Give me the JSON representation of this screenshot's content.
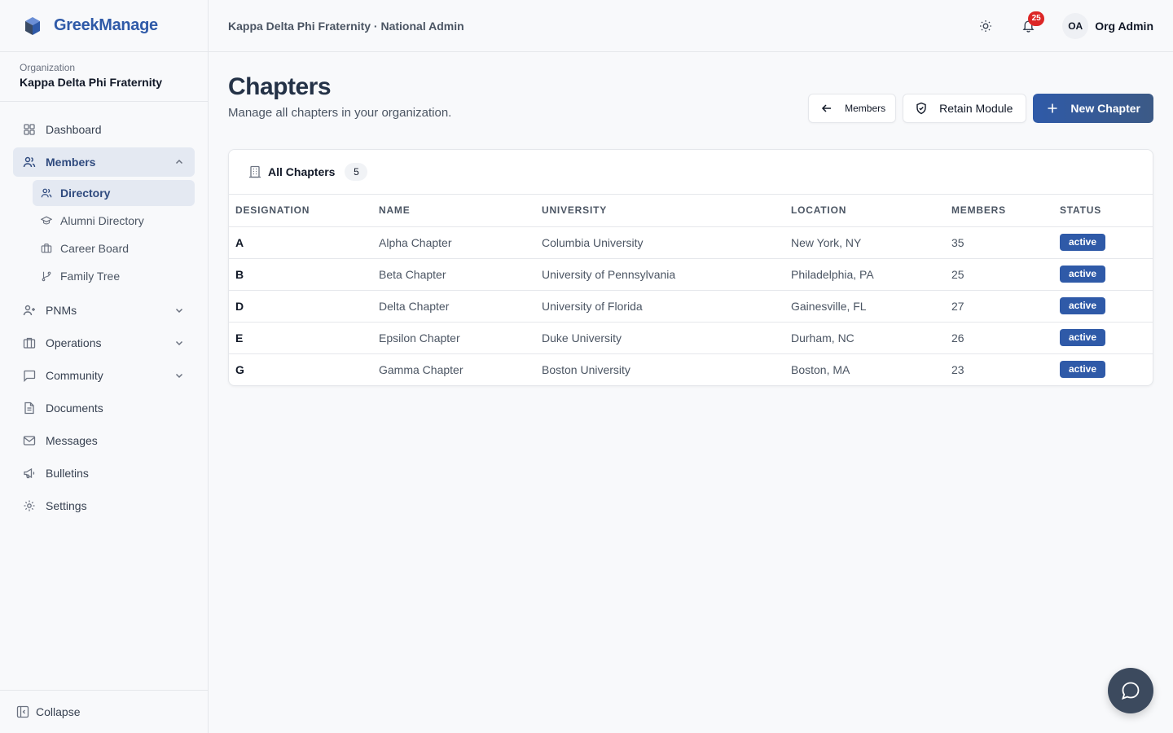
{
  "brand": {
    "name": "GreekManage"
  },
  "org": {
    "label": "Organization",
    "name": "Kappa Delta Phi Fraternity"
  },
  "sidebar": {
    "items": [
      {
        "label": "Dashboard"
      },
      {
        "label": "Members"
      },
      {
        "label": "PNMs"
      },
      {
        "label": "Operations"
      },
      {
        "label": "Community"
      },
      {
        "label": "Documents"
      },
      {
        "label": "Messages"
      },
      {
        "label": "Bulletins"
      },
      {
        "label": "Settings"
      }
    ],
    "members_sub": [
      {
        "label": "Directory"
      },
      {
        "label": "Alumni Directory"
      },
      {
        "label": "Career Board"
      },
      {
        "label": "Family Tree"
      }
    ],
    "collapse_label": "Collapse"
  },
  "header": {
    "context": "Kappa Delta Phi Fraternity · National Admin",
    "notification_count": "25",
    "user_initials": "OA",
    "user_name": "Org Admin"
  },
  "page": {
    "title": "Chapters",
    "subtitle": "Manage all chapters in your organization.",
    "back_label": "Members",
    "retain_label": "Retain Module",
    "new_label": "New Chapter"
  },
  "table": {
    "title": "All Chapters",
    "count": "5",
    "columns": [
      "DESIGNATION",
      "NAME",
      "UNIVERSITY",
      "LOCATION",
      "MEMBERS",
      "STATUS"
    ],
    "rows": [
      {
        "designation": "A",
        "name": "Alpha Chapter",
        "university": "Columbia University",
        "location": "New York, NY",
        "members": "35",
        "status": "active"
      },
      {
        "designation": "B",
        "name": "Beta Chapter",
        "university": "University of Pennsylvania",
        "location": "Philadelphia, PA",
        "members": "25",
        "status": "active"
      },
      {
        "designation": "D",
        "name": "Delta Chapter",
        "university": "University of Florida",
        "location": "Gainesville, FL",
        "members": "27",
        "status": "active"
      },
      {
        "designation": "E",
        "name": "Epsilon Chapter",
        "university": "Duke University",
        "location": "Durham, NC",
        "members": "26",
        "status": "active"
      },
      {
        "designation": "G",
        "name": "Gamma Chapter",
        "university": "Boston University",
        "location": "Boston, MA",
        "members": "23",
        "status": "active"
      }
    ]
  },
  "colors": {
    "primary": "#2f5aa8",
    "badge": "#dc2626",
    "active_bg": "#e4e9f2",
    "chat": "#3c4a5e"
  }
}
